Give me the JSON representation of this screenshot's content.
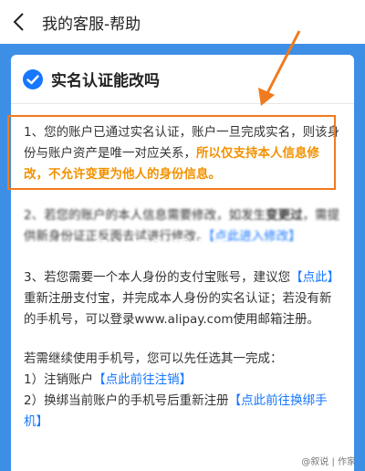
{
  "nav": {
    "title": "我的客服-帮助"
  },
  "question": {
    "title": "实名认证能改吗"
  },
  "p1": {
    "text_a": "1、您的账户已通过实名认证，账户一旦完成实名，则该身份与账户资产是唯一对应关系，",
    "text_b": "所以仅支持本人信息修改，不允许变更为他人的身份信息。"
  },
  "p2": {
    "line1": "2、若您的账户的本人信息需要修改，如发生",
    "line2_bold": "变更过",
    "line2_rest": "，需提供新身份证正反面去试进行修改。",
    "link": "【点此进入修改】"
  },
  "p3": {
    "text_a": "3、若您需要一个本人身份的支付宝账号，建议您",
    "link": "【点此】",
    "text_b": "重新注册支付宝，并完成本人身份的实名认证；若没有新的手机号，可以登录www.alipay.com使用邮箱注册。"
  },
  "p4": {
    "intro": "若需继续使用手机号，您可以先任选其一完成：",
    "opt1": "1）注销账户",
    "opt1_link": "【点此前往注销】",
    "opt2": "2）换绑当前账户的手机号后重新注册",
    "opt2_link": "【点此前往换绑手机】"
  },
  "watermark": {
    "text": "名认证？手把手",
    "corner": "@叙说 | 作家"
  },
  "colors": {
    "accent": "#1677ff",
    "highlight": "#f29100",
    "box": "#f07a1f"
  }
}
